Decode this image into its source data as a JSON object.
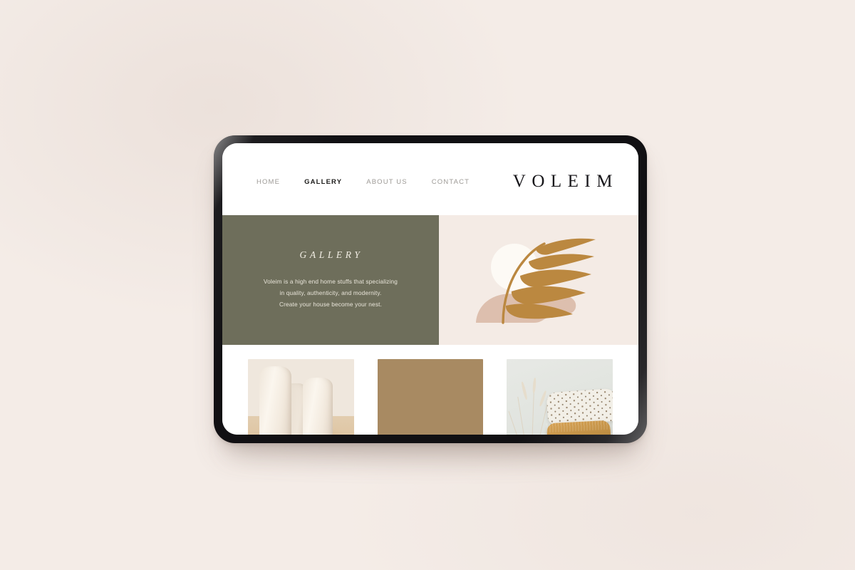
{
  "page": {
    "background_color": "#f4ece7",
    "device": "tablet-mockup",
    "device_bezel_color": "#111013"
  },
  "header": {
    "brand": "VOLEIM",
    "nav": [
      {
        "label": "HOME",
        "active": false
      },
      {
        "label": "GALLERY",
        "active": true
      },
      {
        "label": "ABOUT US",
        "active": false
      },
      {
        "label": "CONTACT",
        "active": false
      }
    ]
  },
  "hero": {
    "panel_color": "#6e6e5b",
    "art_background_color": "#f4ebe5",
    "title": "GALLERY",
    "paragraph_lines": [
      "Voleim is a high end home stuffs that specializing",
      "in quality, authenticity, and modernity.",
      "Create your house become your nest."
    ],
    "art": {
      "name": "palm-frond-illustration",
      "sun_color": "#fdfaf5",
      "rock_color": "#ddbfae",
      "frond_color": "#bb8840"
    }
  },
  "gallery": {
    "items": [
      {
        "name": "ceramic-vases-photo",
        "caption": "Cream ceramic vases on light wood"
      },
      {
        "name": "tan-color-block",
        "caption": "Solid tan color block",
        "color": "#a88a62"
      },
      {
        "name": "pillows-and-dried-grass-photo",
        "caption": "Patterned and ochre velvet pillows with dried grass"
      }
    ]
  }
}
